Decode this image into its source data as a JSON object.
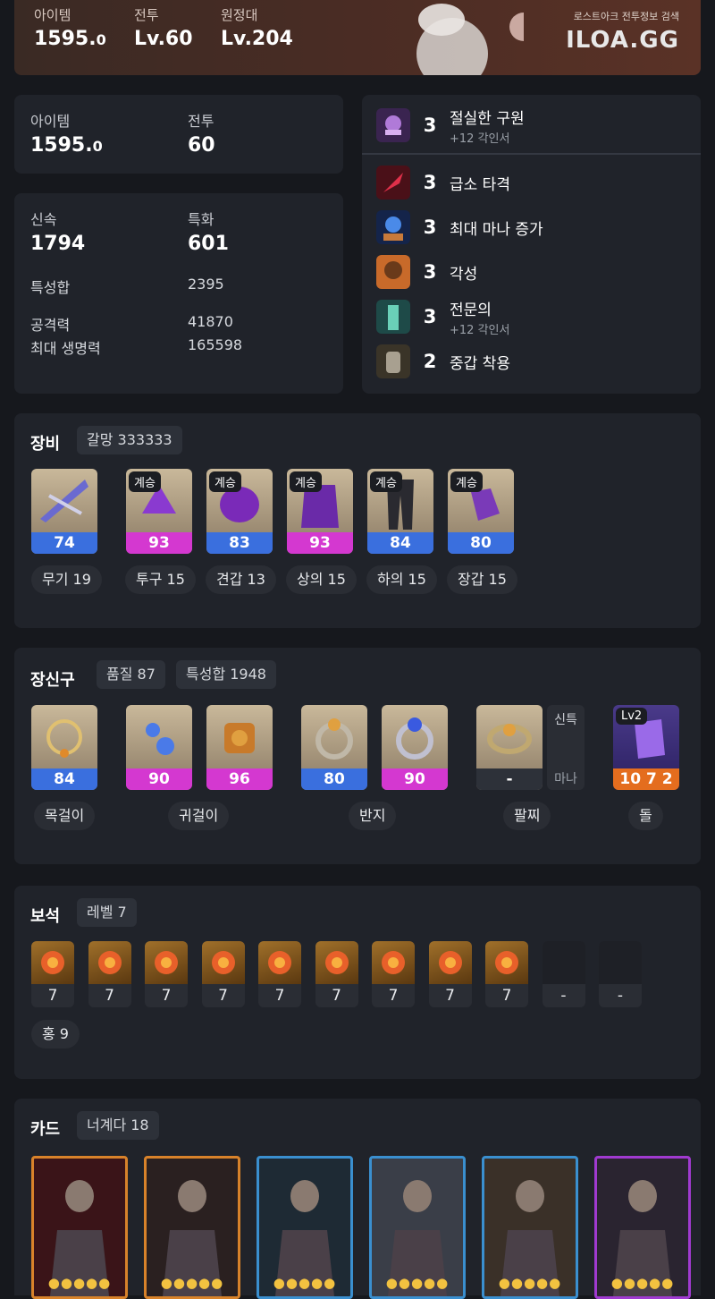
{
  "banner": {
    "item_label": "아이템",
    "item_value": "1595.",
    "item_decimal": "0",
    "combat_label": "전투",
    "combat_value": "Lv.60",
    "roster_label": "원정대",
    "roster_value": "Lv.204",
    "logo_sub": "로스트아크 전투정보 검색",
    "logo": "ILOA.GG"
  },
  "summary": {
    "item_label": "아이템",
    "item_value": "1595.",
    "item_decimal": "0",
    "combat_label": "전투",
    "combat_value": "60"
  },
  "stats": {
    "swift_label": "신속",
    "swift_value": "1794",
    "spec_label": "특화",
    "spec_value": "601",
    "total_label": "특성합",
    "total_value": "2395",
    "atk_label": "공격력",
    "atk_value": "41870",
    "hp_label": "최대 생명력",
    "hp_value": "165598"
  },
  "engravings": [
    {
      "level": "3",
      "name": "절실한 구원",
      "sub": "+12 각인서",
      "icon": "skull-hand-icon"
    },
    {
      "level": "3",
      "name": "급소 타격",
      "sub": "",
      "icon": "strike-icon"
    },
    {
      "level": "3",
      "name": "최대 마나 증가",
      "sub": "",
      "icon": "mana-icon"
    },
    {
      "level": "3",
      "name": "각성",
      "sub": "",
      "icon": "awakening-icon"
    },
    {
      "level": "3",
      "name": "전문의",
      "sub": "+12 각인서",
      "icon": "specialist-icon"
    },
    {
      "level": "2",
      "name": "중갑 착용",
      "sub": "",
      "icon": "heavy-armor-icon"
    }
  ],
  "equipment": {
    "title": "장비",
    "chip": "갈망 333333",
    "items": [
      {
        "quality": "74",
        "tag": "",
        "label": "무기 19",
        "color": "blue"
      },
      {
        "quality": "93",
        "tag": "계승",
        "label": "투구 15",
        "color": "pink"
      },
      {
        "quality": "83",
        "tag": "계승",
        "label": "견갑 13",
        "color": "blue"
      },
      {
        "quality": "93",
        "tag": "계승",
        "label": "상의 15",
        "color": "pink"
      },
      {
        "quality": "84",
        "tag": "계승",
        "label": "하의 15",
        "color": "blue"
      },
      {
        "quality": "80",
        "tag": "계승",
        "label": "장갑 15",
        "color": "blue"
      }
    ]
  },
  "accessories": {
    "title": "장신구",
    "chip_quality": "품질 87",
    "chip_stats": "특성합 1948",
    "items": [
      {
        "quality": "84",
        "color": "blue"
      },
      {
        "quality": "90",
        "color": "pink"
      },
      {
        "quality": "96",
        "color": "pink"
      },
      {
        "quality": "80",
        "color": "blue"
      },
      {
        "quality": "90",
        "color": "pink"
      },
      {
        "quality": "-",
        "color": "gray"
      }
    ],
    "bracelet_side_top": "신특",
    "bracelet_side_bottom": "마나",
    "stone_level": "Lv2",
    "stone_value": "10 7 2",
    "labels": {
      "necklace": "목걸이",
      "earring": "귀걸이",
      "ring": "반지",
      "bracelet": "팔찌",
      "stone": "돌"
    }
  },
  "gems": {
    "title": "보석",
    "chip": "레벨 7",
    "values": [
      "7",
      "7",
      "7",
      "7",
      "7",
      "7",
      "7",
      "7",
      "7",
      "-",
      "-"
    ],
    "summary": "홍 9"
  },
  "cards": {
    "title": "카드",
    "chip": "너계다 18",
    "list": [
      {
        "frame": "#d8822a",
        "stars": "●●●●●"
      },
      {
        "frame": "#d8822a",
        "stars": "●●●●●"
      },
      {
        "frame": "#3a8fcf",
        "stars": "●●●●●"
      },
      {
        "frame": "#3a8fcf",
        "stars": "●●●●●"
      },
      {
        "frame": "#3a8fcf",
        "stars": "●●●●●"
      },
      {
        "frame": "#a03ad0",
        "stars": "●●●●●"
      }
    ]
  },
  "colors": {
    "blue": "#3a6fde",
    "pink": "#d438d0",
    "orange": "#e46d1e",
    "panel": "#20232a",
    "bg": "#16181d"
  }
}
